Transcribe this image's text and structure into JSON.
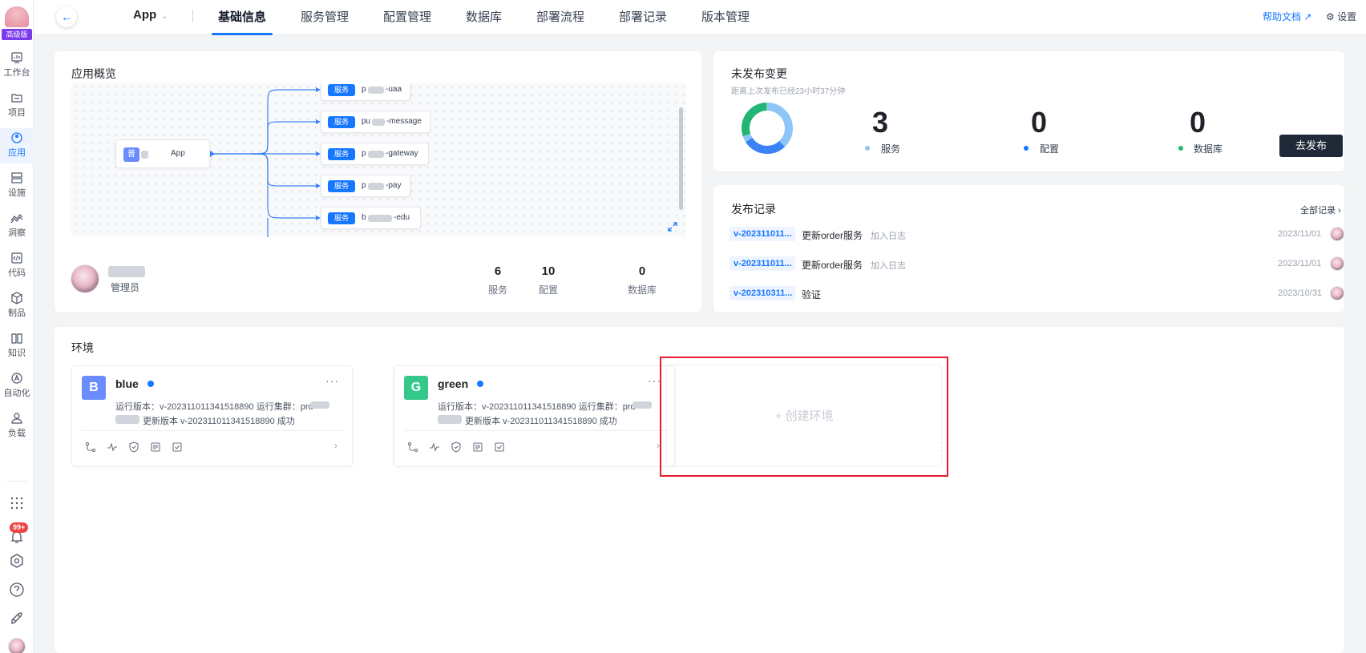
{
  "rail": {
    "badge": "高级版",
    "items": [
      {
        "label": "工作台",
        "icon": "dashboard-icon"
      },
      {
        "label": "项目",
        "icon": "folder-icon"
      },
      {
        "label": "应用",
        "icon": "app-icon"
      },
      {
        "label": "设施",
        "icon": "server-icon"
      },
      {
        "label": "洞察",
        "icon": "insight-icon"
      },
      {
        "label": "代码",
        "icon": "code-icon"
      },
      {
        "label": "制品",
        "icon": "package-icon"
      },
      {
        "label": "知识",
        "icon": "book-icon"
      },
      {
        "label": "自动化",
        "icon": "automation-icon"
      },
      {
        "label": "负载",
        "icon": "load-icon"
      }
    ],
    "notification_count": "99+"
  },
  "header": {
    "app_name": "App",
    "tabs": [
      "基础信息",
      "服务管理",
      "配置管理",
      "数据库",
      "部署流程",
      "部署记录",
      "版本管理"
    ],
    "active_tab": "基础信息",
    "help_label": "帮助文档",
    "settings_label": "设置"
  },
  "overview": {
    "title": "应用概览",
    "app_node_icon_text": "普",
    "app_node_label": "App",
    "service_tag": "服务",
    "services": [
      {
        "prefix": "p",
        "suffix": "-uaa"
      },
      {
        "prefix": "pu",
        "suffix": "-message"
      },
      {
        "prefix": "p",
        "suffix": "-gateway"
      },
      {
        "prefix": "p",
        "suffix": "-pay"
      },
      {
        "prefix": "b",
        "suffix": "-edu"
      }
    ],
    "role": "管理员",
    "stats": [
      {
        "value": "6",
        "label": "服务"
      },
      {
        "value": "10",
        "label": "配置"
      },
      {
        "value": "0",
        "label": "数据库"
      }
    ]
  },
  "unpublished": {
    "title": "未发布变更",
    "subtitle": "距离上次发布已经23小时37分钟",
    "stats": [
      {
        "value": "3",
        "label": "服务",
        "color": "#8ec5f7"
      },
      {
        "value": "0",
        "label": "配置",
        "color": "#1677ff"
      },
      {
        "value": "0",
        "label": "数据库",
        "color": "#22b573"
      }
    ],
    "publish_button": "去发布"
  },
  "records": {
    "title": "发布记录",
    "all_link": "全部记录",
    "items": [
      {
        "version": "v-202311011...",
        "title": "更新order服务",
        "sub": "加入日志",
        "date": "2023/11/01"
      },
      {
        "version": "v-202311011...",
        "title": "更新order服务",
        "sub": "加入日志",
        "date": "2023/11/01"
      },
      {
        "version": "v-202310311...",
        "title": "验证",
        "sub": "",
        "date": "2023/10/31"
      }
    ]
  },
  "environments": {
    "title": "环境",
    "cards": [
      {
        "letter": "B",
        "name": "blue",
        "color": "#6b8cff",
        "line1": "运行版本：v-202311011341518890   运行集群：prd",
        "line2": "更新版本 v-202311011341518890 成功"
      },
      {
        "letter": "G",
        "name": "green",
        "color": "#34c98b",
        "line1": "运行版本：v-202311011341518890   运行集群：prd",
        "line2": "更新版本 v-202311011341518890 成功"
      }
    ],
    "more": "···",
    "create_label": "创建环境"
  }
}
